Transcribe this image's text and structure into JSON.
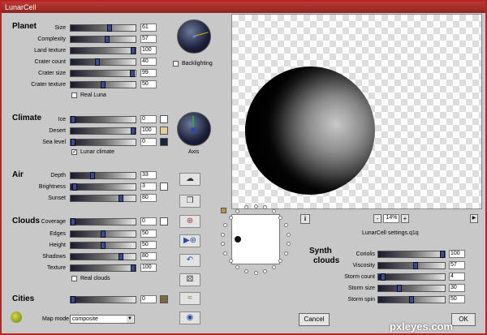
{
  "window": {
    "title": "LunarCell"
  },
  "sections": {
    "planet": "Planet",
    "climate": "Climate",
    "air": "Air",
    "clouds": "Clouds",
    "cities": "Cities",
    "synth_clouds_line1": "Synth",
    "synth_clouds_line2": "clouds"
  },
  "planet": {
    "rows": [
      {
        "label": "Size",
        "value": "61",
        "pos": 0.61
      },
      {
        "label": "Complexity",
        "value": "57",
        "pos": 0.57
      },
      {
        "label": "Land texture",
        "value": "100",
        "pos": 1.0
      },
      {
        "label": "Crater count",
        "value": "40",
        "pos": 0.4
      },
      {
        "label": "Crater size",
        "value": "99",
        "pos": 0.99
      },
      {
        "label": "Crater texture",
        "value": "50",
        "pos": 0.5
      }
    ],
    "backlighting": "Backlighting",
    "real_luna": "Real Luna"
  },
  "climate": {
    "rows": [
      {
        "label": "Ice",
        "value": "0",
        "pos": 0.0,
        "swatch": "#ffffff"
      },
      {
        "label": "Desert",
        "value": "100",
        "pos": 1.0,
        "swatch": "#e8cc9a"
      },
      {
        "label": "Sea level",
        "value": "0",
        "pos": 0.0,
        "swatch": "#1a2244"
      }
    ],
    "lunar_climate": "Lunar climate",
    "lunar_climate_checked": "✓",
    "axis": "Axis"
  },
  "air": {
    "rows": [
      {
        "label": "Depth",
        "value": "33",
        "pos": 0.33
      },
      {
        "label": "Brightness",
        "value": "3",
        "pos": 0.03,
        "swatch": "#ffffff"
      },
      {
        "label": "Sunset",
        "value": "80",
        "pos": 0.8
      }
    ]
  },
  "clouds": {
    "rows": [
      {
        "label": "Coverage",
        "value": "0",
        "pos": 0.0,
        "swatch": "#ffffff"
      },
      {
        "label": "Edges",
        "value": "50",
        "pos": 0.5
      },
      {
        "label": "Height",
        "value": "50",
        "pos": 0.5
      },
      {
        "label": "Shadows",
        "value": "80",
        "pos": 0.8
      },
      {
        "label": "Texture",
        "value": "100",
        "pos": 1.0
      }
    ],
    "real_clouds": "Real clouds"
  },
  "cities": {
    "value": "0",
    "pos": 0.0,
    "swatch": "#7a6a40"
  },
  "map_mode": {
    "label": "Map mode",
    "value": "composite"
  },
  "synth": {
    "rows": [
      {
        "label": "Coriolis",
        "value": "100",
        "pos": 1.0
      },
      {
        "label": "Viscosity",
        "value": "57",
        "pos": 0.57
      },
      {
        "label": "Storm count",
        "value": "4",
        "pos": 0.04
      },
      {
        "label": "Storm size",
        "value": "30",
        "pos": 0.3
      },
      {
        "label": "Storm spin",
        "value": "50",
        "pos": 0.5
      }
    ]
  },
  "zoom": {
    "minus": "-",
    "value": "14%",
    "plus": "+"
  },
  "settings_file": "LunarCell settings.q1q",
  "info": "i",
  "buttons": {
    "cancel": "Cancel",
    "ok": "OK"
  },
  "watermark": "pxleyes.com"
}
